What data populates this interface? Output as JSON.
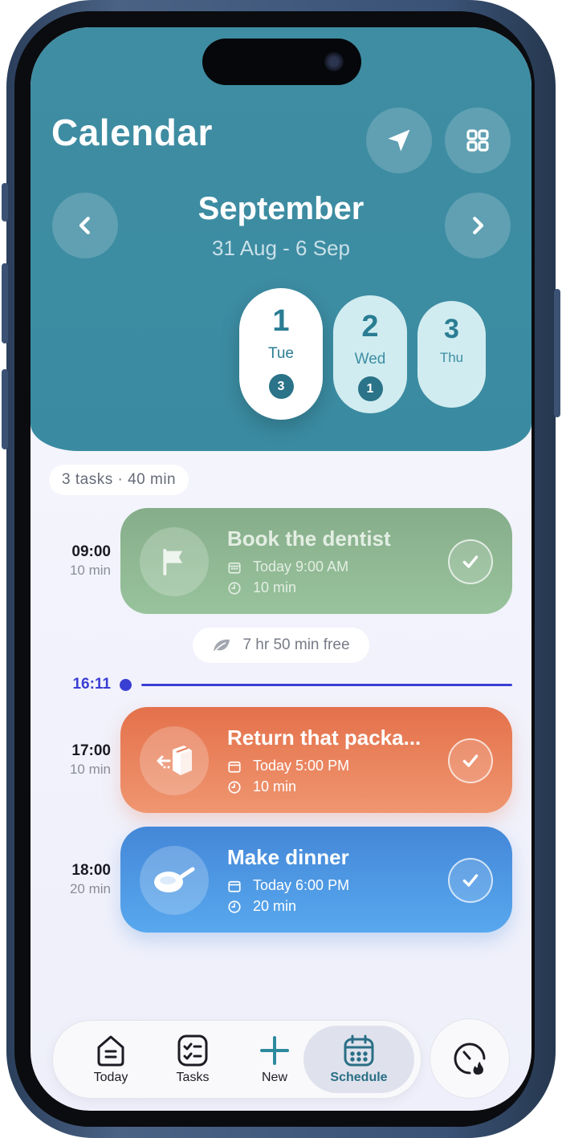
{
  "header": {
    "title": "Calendar",
    "month": "September",
    "week_range": "31 Aug - 6 Sep"
  },
  "days": [
    {
      "num": "1",
      "name": "Tue",
      "badge": "3",
      "selected": true
    },
    {
      "num": "2",
      "name": "Wed",
      "badge": "1",
      "selected": false
    },
    {
      "num": "3",
      "name": "Thu",
      "badge": "",
      "selected": false
    }
  ],
  "summary": "3 tasks · 40 min",
  "tasks": [
    {
      "time": "09:00",
      "duration": "10 min",
      "title": "Book the dentist",
      "date_text": "Today 9:00 AM",
      "length": "10 min",
      "icon": "flag-icon",
      "color_top": "#86ad8a",
      "color_bottom": "#98c39c"
    },
    {
      "time": "17:00",
      "duration": "10 min",
      "title": "Return that packa...",
      "date_text": "Today 5:00 PM",
      "length": "10 min",
      "icon": "package-return-icon",
      "color_top": "#e4714b",
      "color_bottom": "#ef9670"
    },
    {
      "time": "18:00",
      "duration": "20 min",
      "title": "Make dinner",
      "date_text": "Today 6:00 PM",
      "length": "20 min",
      "icon": "frying-pan-icon",
      "color_top": "#4487d8",
      "color_bottom": "#58a8ee"
    }
  ],
  "free_time": "7 hr 50 min free",
  "now": "16:11",
  "tabs": [
    {
      "label": "Today",
      "icon": "home-icon"
    },
    {
      "label": "Tasks",
      "icon": "checklist-icon"
    },
    {
      "label": "New",
      "icon": "plus-icon"
    },
    {
      "label": "Schedule",
      "icon": "calendar-icon",
      "active": true
    }
  ],
  "colors": {
    "header": "#3f8da3",
    "now_line": "#3a3fd4",
    "accent": "#2a7d93"
  }
}
